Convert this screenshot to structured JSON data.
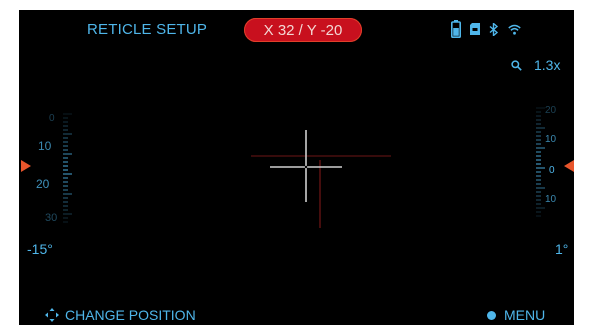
{
  "header": {
    "title": "RETICLE SETUP",
    "position_readout": "X 32 / Y -20"
  },
  "status_icons": [
    "battery-icon",
    "sd-card-icon",
    "bluetooth-icon",
    "wifi-icon"
  ],
  "zoom": {
    "icon": "magnifier-icon",
    "value": "1.3x"
  },
  "left_gauge": {
    "labels": [
      "0",
      "10",
      "20",
      "30"
    ],
    "angle": "-15°"
  },
  "right_gauge": {
    "labels": [
      "20",
      "10",
      "0",
      "10"
    ],
    "angle": "1°"
  },
  "footer": {
    "change_position": "CHANGE POSITION",
    "change_position_icon": "move-arrows-icon",
    "menu": "MENU"
  },
  "colors": {
    "background": "#000000",
    "accent_blue": "#4fb6ea",
    "readout_red": "#c8101e",
    "marker_orange": "#e8552b"
  }
}
